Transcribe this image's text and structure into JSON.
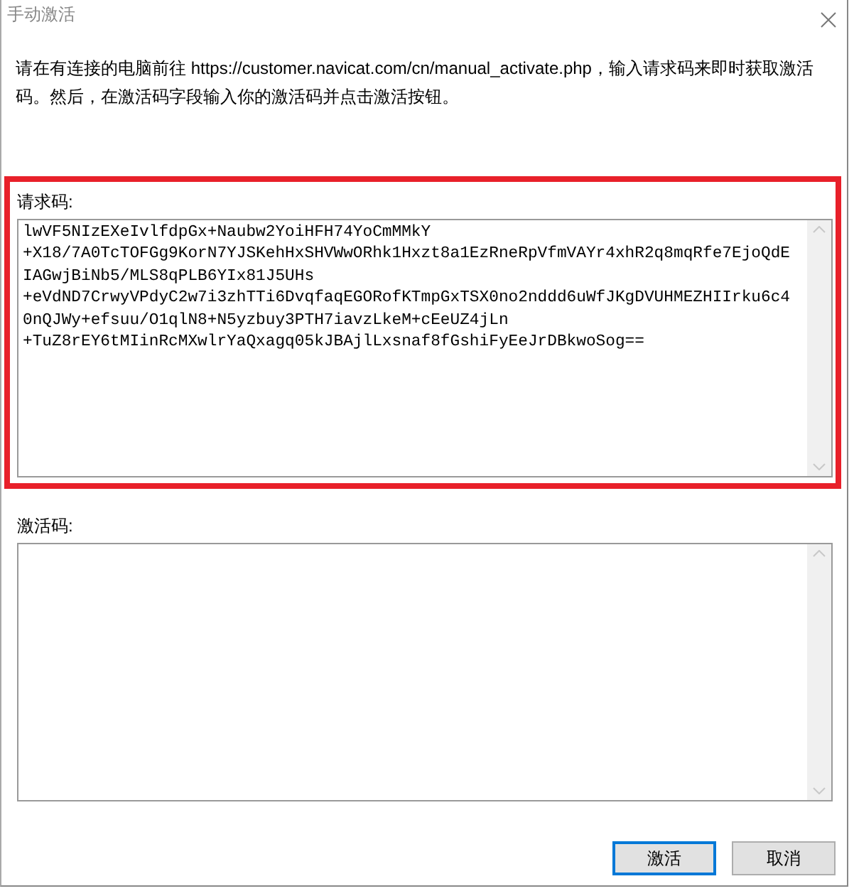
{
  "window": {
    "title": "手动激活"
  },
  "instructions": "请在有连接的电脑前往 https://customer.navicat.com/cn/manual_activate.php，输入请求码来即时获取激活码。然后，在激活码字段输入你的激活码并点击激活按钮。",
  "request_code": {
    "label": "请求码:",
    "highlighted": true,
    "lines": [
      "lwVF5NIzEXeIvlfdpGx+Naubw2YoiHFH74YoCmMMkY",
      "+X18/7A0TcTOFGg9KorN7YJSKehHxSHVWwORhk1Hxzt8a1EzRneRpVfmVAYr4xhR2q8mqRfe7EjoQdE",
      "IAGwjBiNb5/MLS8qPLB6YIx81J5UHs",
      "+eVdND7CrwyVPdyC2w7i3zhTTi6DvqfaqEGORofKTmpGxTSX0no2nddd6uWfJKgDVUHMEZHIIrku6c4",
      "0nQJWy+efsuu/O1qlN8+N5yzbuy3PTH7iavzLkeM+cEeUZ4jLn",
      "+TuZ8rEY6tMIinRcMXwlrYaQxagq05kJBAjlLxsnaf8fGshiFyEeJrDBkwoSog=="
    ]
  },
  "activation_code": {
    "label": "激活码:"
  },
  "buttons": [
    {
      "label": "激活",
      "focused": true
    },
    {
      "label": "取消",
      "focused": false
    }
  ]
}
